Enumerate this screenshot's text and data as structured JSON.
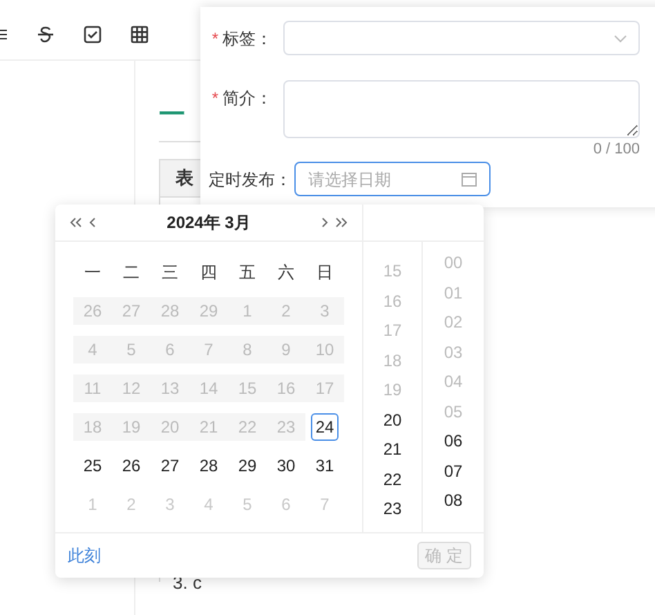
{
  "document": {
    "heading": "一",
    "table_header": "表",
    "list_item": "3. c"
  },
  "form": {
    "fields": [
      {
        "kind": "select",
        "label": "标签：",
        "required_mark": "*"
      },
      {
        "kind": "textarea",
        "label": "简介：",
        "required_mark": "*",
        "counter": "0 / 100"
      },
      {
        "kind": "date",
        "label": "定时发布：",
        "placeholder": "请选择日期",
        "focused": true
      }
    ]
  },
  "picker": {
    "title": "2024年 3月",
    "weekdays": [
      "一",
      "二",
      "三",
      "四",
      "五",
      "六",
      "日"
    ],
    "weeks": [
      [
        {
          "day": "26",
          "disabled": true,
          "today": false
        },
        {
          "day": "27",
          "disabled": true,
          "today": false
        },
        {
          "day": "28",
          "disabled": true,
          "today": false
        },
        {
          "day": "29",
          "disabled": true,
          "today": false
        },
        {
          "day": "1",
          "disabled": true,
          "today": false
        },
        {
          "day": "2",
          "disabled": true,
          "today": false
        },
        {
          "day": "3",
          "disabled": true,
          "today": false
        }
      ],
      [
        {
          "day": "4",
          "disabled": true,
          "today": false
        },
        {
          "day": "5",
          "disabled": true,
          "today": false
        },
        {
          "day": "6",
          "disabled": true,
          "today": false
        },
        {
          "day": "7",
          "disabled": true,
          "today": false
        },
        {
          "day": "8",
          "disabled": true,
          "today": false
        },
        {
          "day": "9",
          "disabled": true,
          "today": false
        },
        {
          "day": "10",
          "disabled": true,
          "today": false
        }
      ],
      [
        {
          "day": "11",
          "disabled": true,
          "today": false
        },
        {
          "day": "12",
          "disabled": true,
          "today": false
        },
        {
          "day": "13",
          "disabled": true,
          "today": false
        },
        {
          "day": "14",
          "disabled": true,
          "today": false
        },
        {
          "day": "15",
          "disabled": true,
          "today": false
        },
        {
          "day": "16",
          "disabled": true,
          "today": false
        },
        {
          "day": "17",
          "disabled": true,
          "today": false
        }
      ],
      [
        {
          "day": "18",
          "disabled": true,
          "today": false
        },
        {
          "day": "19",
          "disabled": true,
          "today": false
        },
        {
          "day": "20",
          "disabled": true,
          "today": false
        },
        {
          "day": "21",
          "disabled": true,
          "today": false
        },
        {
          "day": "22",
          "disabled": true,
          "today": false
        },
        {
          "day": "23",
          "disabled": true,
          "today": false
        },
        {
          "day": "24",
          "disabled": false,
          "today": true
        }
      ],
      [
        {
          "day": "25",
          "disabled": false,
          "outside": false,
          "today": false
        },
        {
          "day": "26",
          "disabled": false,
          "outside": false,
          "today": false
        },
        {
          "day": "27",
          "disabled": false,
          "outside": false,
          "today": false
        },
        {
          "day": "28",
          "disabled": false,
          "outside": false,
          "today": false
        },
        {
          "day": "29",
          "disabled": false,
          "outside": false,
          "today": false
        },
        {
          "day": "30",
          "disabled": false,
          "outside": false,
          "today": false
        },
        {
          "day": "31",
          "disabled": false,
          "outside": false,
          "today": false
        }
      ],
      [
        {
          "day": "1",
          "disabled": false,
          "outside": true,
          "today": false
        },
        {
          "day": "2",
          "disabled": false,
          "outside": true,
          "today": false
        },
        {
          "day": "3",
          "disabled": false,
          "outside": true,
          "today": false
        },
        {
          "day": "4",
          "disabled": false,
          "outside": true,
          "today": false
        },
        {
          "day": "5",
          "disabled": false,
          "outside": true,
          "today": false
        },
        {
          "day": "6",
          "disabled": false,
          "outside": true,
          "today": false
        },
        {
          "day": "7",
          "disabled": false,
          "outside": true,
          "today": false
        }
      ]
    ],
    "hours": [
      {
        "label": "15",
        "disabled": true
      },
      {
        "label": "16",
        "disabled": true
      },
      {
        "label": "17",
        "disabled": true
      },
      {
        "label": "18",
        "disabled": true
      },
      {
        "label": "19",
        "disabled": true
      },
      {
        "label": "20",
        "disabled": false
      },
      {
        "label": "21",
        "disabled": false
      },
      {
        "label": "22",
        "disabled": false
      },
      {
        "label": "23",
        "disabled": false
      }
    ],
    "minutes": [
      {
        "label": "00",
        "disabled": true
      },
      {
        "label": "01",
        "disabled": true
      },
      {
        "label": "02",
        "disabled": true
      },
      {
        "label": "03",
        "disabled": true
      },
      {
        "label": "04",
        "disabled": true
      },
      {
        "label": "05",
        "disabled": true
      },
      {
        "label": "06",
        "disabled": false
      },
      {
        "label": "07",
        "disabled": false
      },
      {
        "label": "08",
        "disabled": false
      }
    ],
    "now_button": "此刻",
    "confirm_button": {
      "label": "确 定",
      "disabled": true
    }
  }
}
